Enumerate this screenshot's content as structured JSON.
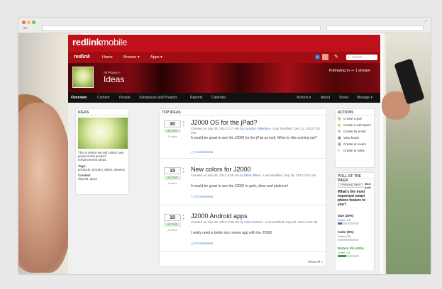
{
  "site": {
    "brand_bold": "redlink",
    "brand_rest": "mobile",
    "nav_logo": "redlink",
    "nav": [
      "Home",
      "Browse ▾",
      "Apps ▾"
    ],
    "notification_count": "1",
    "search_placeholder": "Search"
  },
  "banner": {
    "breadcrumb": "All Places »",
    "title": "Ideas",
    "following": "Following in ⇀ 1 stream"
  },
  "subnav": {
    "left": [
      "Overview",
      "Content",
      "People",
      "Subspaces and Projects",
      "Reports",
      "Calendar"
    ],
    "right": [
      "Actions ▾",
      "About",
      "Share",
      "Manage ▾"
    ]
  },
  "ideas_box": {
    "header": "IDEAS",
    "description": "This is where we will collect new product and product enhancement ideas.",
    "tags_label": "Tags:",
    "tags": "products, product_ideas, ideation",
    "created_label": "Created:",
    "created": "Sep 25, 2013"
  },
  "top_ideas": {
    "header": "TOP IDEAS",
    "show_all": "Show All »",
    "items": [
      {
        "score": "30",
        "status": "ACTIVE",
        "votes": "6 votes",
        "title": "J2000 OS for the jPad?",
        "meta_pre": "Created on Sep 26, 2013 3:27 AM by ",
        "author": "Lourdes Villalobos",
        "meta_post": " - Last Modified: Dec 31, 2013 7:02 PM",
        "body": "It would be great to see the J2000 for the jPad as well. When is this coming out?",
        "comments": "4 Comments"
      },
      {
        "score": "15",
        "status": "ACTIVE",
        "votes": "3 votes",
        "title": "New colors for J2000",
        "meta_pre": "Created on Sep 26, 2013 2:55 AM by ",
        "author": "Mark White",
        "meta_post": " - Last Modified: Sep 26, 2013 2:55 AM",
        "body": "It would be great to see the J2000 in gold, silver and platinum!",
        "comments": "0 Comments"
      },
      {
        "score": "10",
        "status": "ACTIVE",
        "votes": "2 votes",
        "title": "J2000 Android apps",
        "meta_pre": "Created on Sep 26, 2013 3:09 AM by ",
        "author": "Gina Graves",
        "meta_post": " - Last Modified: Sep 26, 2013 3:09 AM",
        "body": "I really need a better doc review app with the J2000.",
        "comments": "0 Comments"
      }
    ]
  },
  "actions": {
    "header": "ACTIONS",
    "items": [
      {
        "icon": "poll-icon",
        "glyph": "▥",
        "label": "Create a poll",
        "color": "#2f9c3d"
      },
      {
        "icon": "subspace-icon",
        "glyph": "◉",
        "label": "Create a sub-space",
        "color": "#e0a12b"
      },
      {
        "icon": "email-icon",
        "glyph": "✉",
        "label": "Create by email",
        "color": "#555555"
      },
      {
        "icon": "feeds-icon",
        "glyph": "▣",
        "label": "View feeds",
        "color": "#3b73b9"
      },
      {
        "icon": "event-icon",
        "glyph": "▤",
        "label": "Create an event",
        "color": "#c0111a"
      },
      {
        "icon": "idea-icon",
        "glyph": "●",
        "label": "Create an idea",
        "color": "#e8b923"
      }
    ]
  },
  "poll": {
    "header": "POLL OF THE WEEK",
    "prev": "‹ Previous",
    "next": "Next ›",
    "more": "More polls",
    "question": "What's the most important smart phone feature to you?",
    "options": [
      {
        "label": "Size (20%)",
        "votes": "Votes: 1/5",
        "pct": 20,
        "winner": false
      },
      {
        "label": "Color (0%)",
        "votes": "Votes: 0/5",
        "pct": 0,
        "winner": false
      },
      {
        "label": "Battery life (40%)",
        "votes": "Votes: 2/5",
        "pct": 40,
        "winner": true
      }
    ]
  }
}
